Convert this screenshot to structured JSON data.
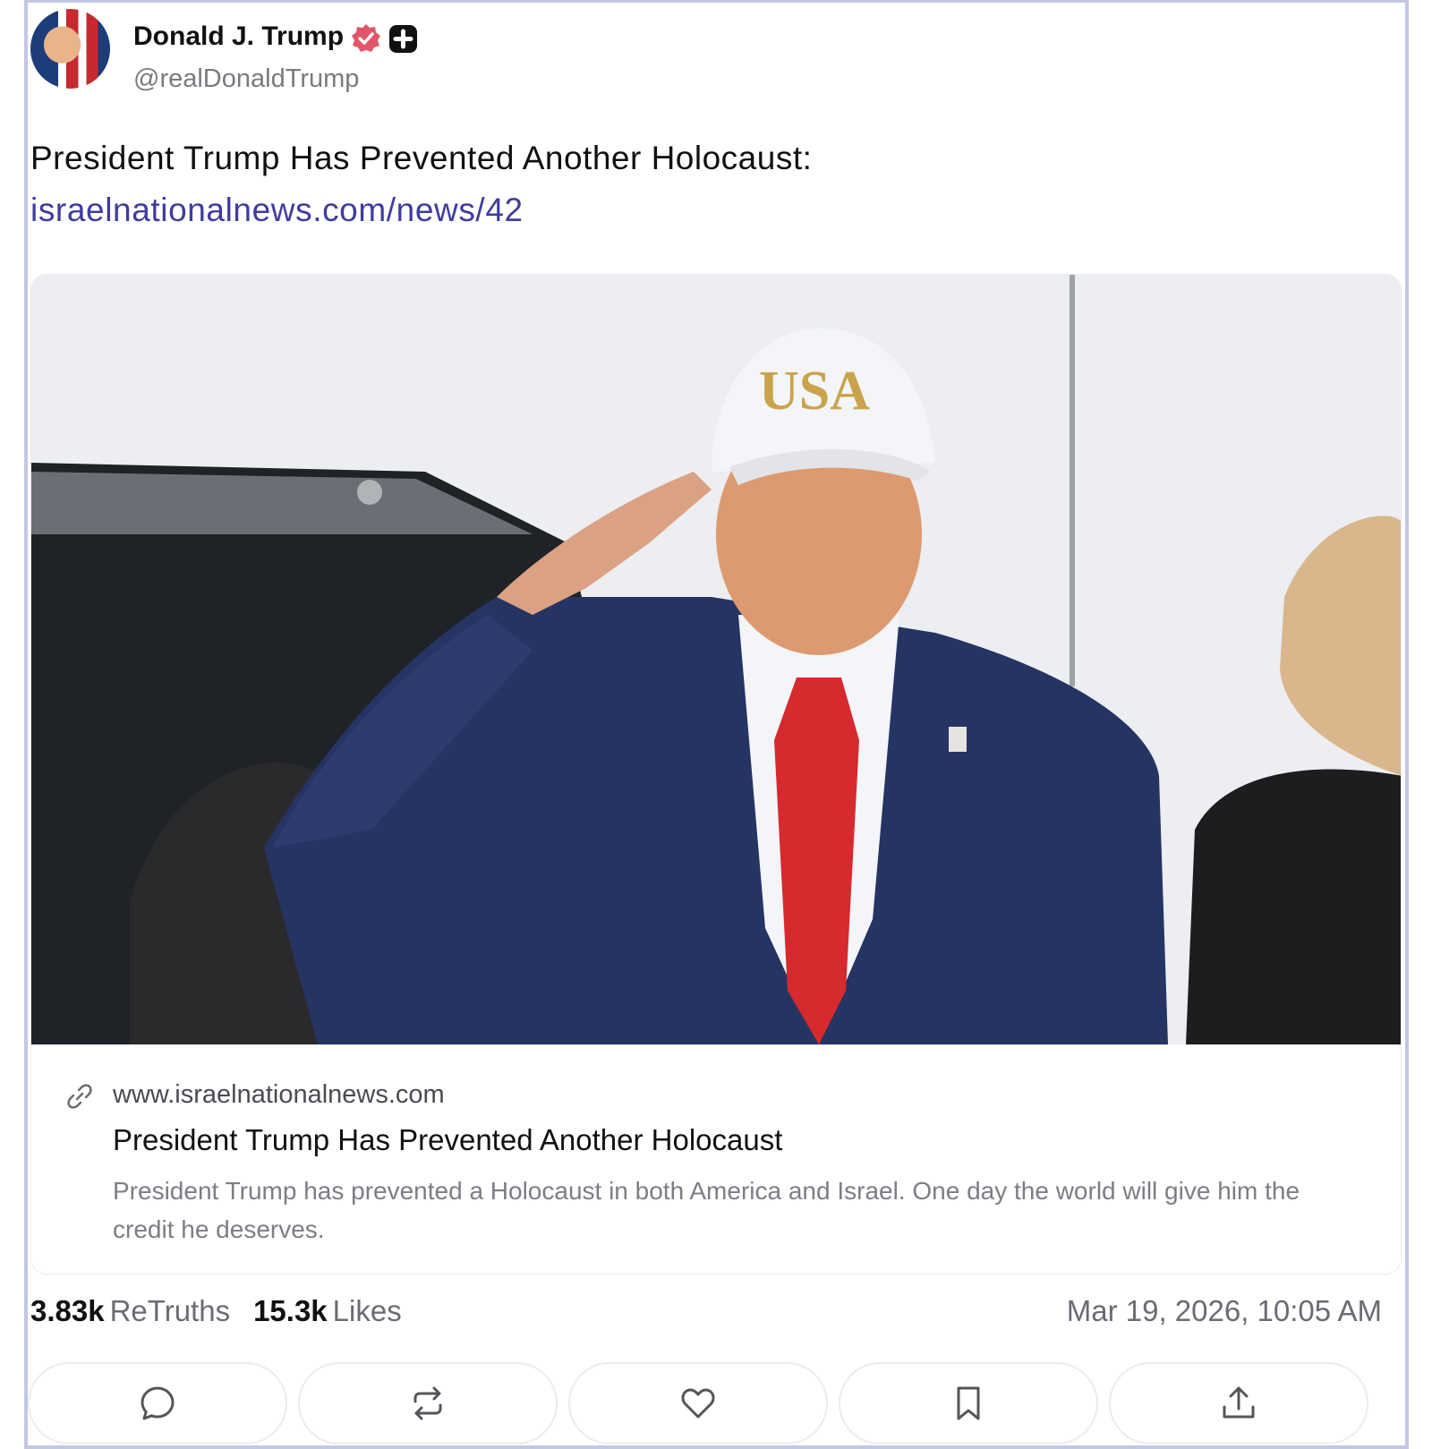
{
  "post": {
    "author": {
      "display_name": "Donald J. Trump",
      "handle": "@realDonaldTrump",
      "verified_icon": "verified-badge-icon",
      "plus_icon": "plus-badge-icon"
    },
    "text": "President Trump Has Prevented Another Holocaust:",
    "link_text": "israelnationalnews.com/news/42",
    "link_card": {
      "image_text": "USA",
      "domain": "www.israelnationalnews.com",
      "title": "President Trump Has Prevented Another Holocaust",
      "description": "President Trump has prevented a Holocaust in both America and Israel. One day the world will give him the credit he deserves."
    },
    "stats": {
      "retruths_count": "3.83k",
      "retruths_label": "ReTruths",
      "likes_count": "15.3k",
      "likes_label": "Likes"
    },
    "timestamp": "Mar 19, 2026, 10:05 AM",
    "actions": [
      {
        "icon": "reply-icon"
      },
      {
        "icon": "retruth-icon"
      },
      {
        "icon": "like-icon"
      },
      {
        "icon": "bookmark-icon"
      },
      {
        "icon": "share-icon"
      }
    ]
  },
  "colors": {
    "frame_border": "#c3c7e3",
    "link": "#3f3c9e",
    "verified": "#e2566a",
    "muted_text": "#6b6b73"
  }
}
